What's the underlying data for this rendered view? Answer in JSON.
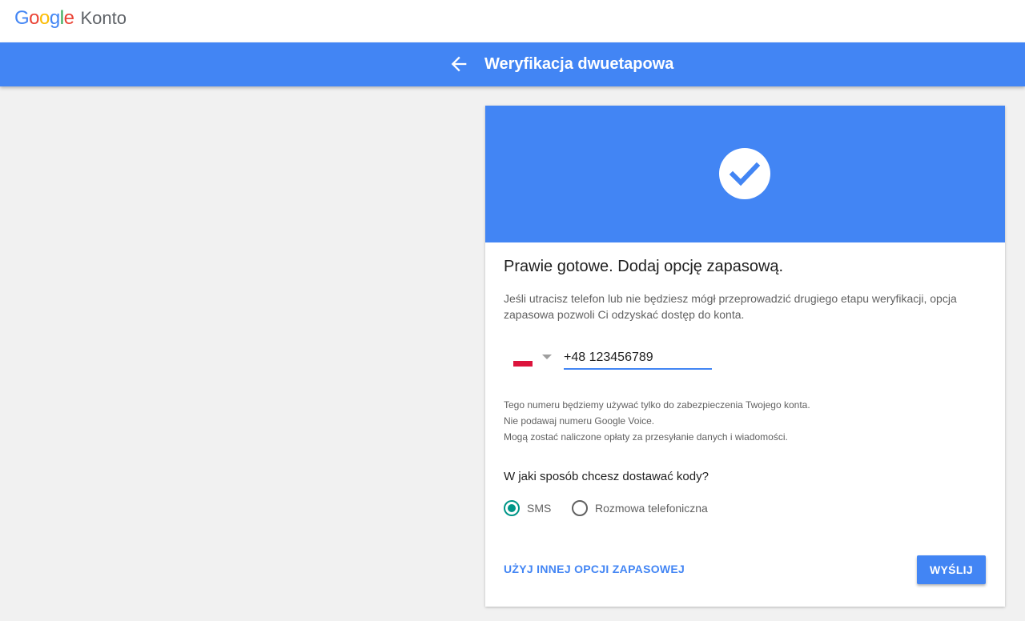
{
  "header": {
    "logo_letters": [
      {
        "char": "G",
        "color": "#4285f4"
      },
      {
        "char": "o",
        "color": "#ea4335"
      },
      {
        "char": "o",
        "color": "#fbbc05"
      },
      {
        "char": "g",
        "color": "#4285f4"
      },
      {
        "char": "l",
        "color": "#34a853"
      },
      {
        "char": "e",
        "color": "#ea4335"
      }
    ],
    "product_name": "Konto"
  },
  "appbar": {
    "back_icon": "arrow-back-icon",
    "title": "Weryfikacja dwuetapowa",
    "color": "#4285f4"
  },
  "card": {
    "hero_icon": "check-circle-icon",
    "title": "Prawie gotowe. Dodaj opcję zapasową.",
    "description": "Jeśli utracisz telefon lub nie będziesz mógł przeprowadzić drugiego etapu weryfikacji, opcja zapasowa pozwoli Ci odzyskać dostęp do konta.",
    "country_flag": "poland-flag-icon",
    "phone_value": "+48 123456789",
    "notes": [
      "Tego numeru będziemy używać tylko do zabezpieczenia Twojego konta.",
      "Nie podawaj numeru Google Voice.",
      "Mogą zostać naliczone opłaty za przesyłanie danych i wiadomości."
    ],
    "question": "W jaki sposób chcesz dostawać kody?",
    "options": [
      {
        "label": "SMS",
        "selected": true
      },
      {
        "label": "Rozmowa telefoniczna",
        "selected": false
      }
    ],
    "alt_option_label": "UŻYJ INNEJ OPCJI ZAPASOWEJ",
    "send_label": "WYŚLIJ"
  }
}
